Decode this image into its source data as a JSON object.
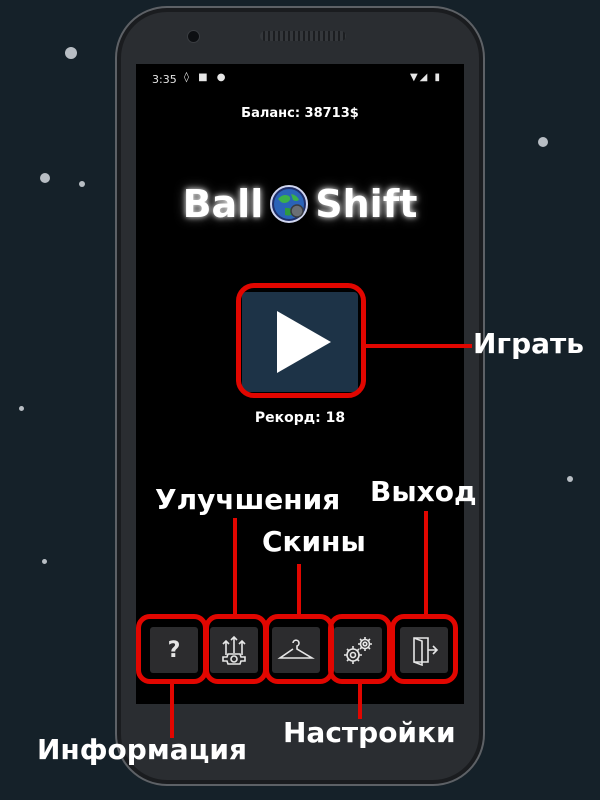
{
  "status_bar": {
    "time": "3:35"
  },
  "balance": "Баланс: 38713$",
  "title": {
    "left": "Ball",
    "right": "Shift"
  },
  "record": "Рекорд: 18",
  "buttons": {
    "info": "?"
  },
  "callouts": {
    "play": "Играть",
    "upgrades": "Улучшения",
    "exit": "Выход",
    "skins": "Скины",
    "info": "Информация",
    "settings": "Настройки"
  },
  "colors": {
    "background": "#152129",
    "screen": "#000000",
    "play_button": "#1d3347",
    "menu_button": "#2c2c2e",
    "highlight": "#e10600"
  },
  "icons": [
    "globe-icon",
    "play-icon",
    "question-icon",
    "upgrade-arrows-gear-icon",
    "hanger-icon",
    "gears-icon",
    "exit-door-icon"
  ]
}
